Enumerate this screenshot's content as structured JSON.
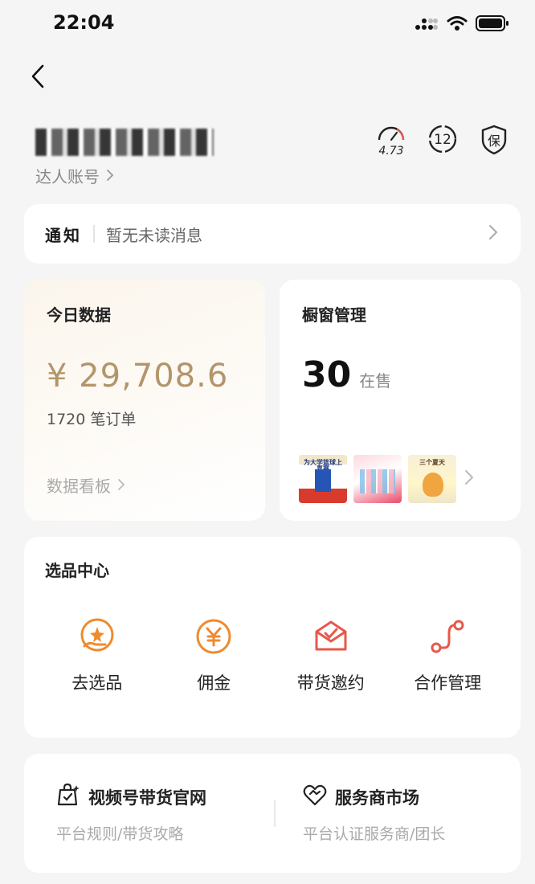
{
  "status_bar": {
    "time": "22:04"
  },
  "account": {
    "type_label": "达人账号",
    "score": "4.73",
    "badge_number": "12",
    "guarantee_label": "保"
  },
  "notice": {
    "title": "通知",
    "message": "暂无未读消息"
  },
  "today_data": {
    "title": "今日数据",
    "amount": "¥ 29,708.6",
    "orders": "1720 笔订单",
    "link": "数据看板"
  },
  "window_mgmt": {
    "title": "橱窗管理",
    "count": "30",
    "unit": "在售",
    "thumb_labels": [
      "为大学篮球上嘉赛",
      "",
      "三个夏天"
    ]
  },
  "selection_center": {
    "title": "选品中心",
    "items": [
      {
        "label": "去选品",
        "icon": "select-product-icon"
      },
      {
        "label": "佣金",
        "icon": "yen-icon"
      },
      {
        "label": "带货邀约",
        "icon": "invitation-icon"
      },
      {
        "label": "合作管理",
        "icon": "cooperation-icon"
      }
    ]
  },
  "bottom_links": [
    {
      "title": "视频号带货官网",
      "subtitle": "平台规则/带货攻略",
      "icon": "bag-check-icon"
    },
    {
      "title": "服务商市场",
      "subtitle": "平台认证服务商/团长",
      "icon": "heart-handshake-icon"
    }
  ],
  "colors": {
    "accent_orange": "#f08a2e",
    "accent_red": "#e8584a",
    "amount_gold": "#b3956c"
  }
}
